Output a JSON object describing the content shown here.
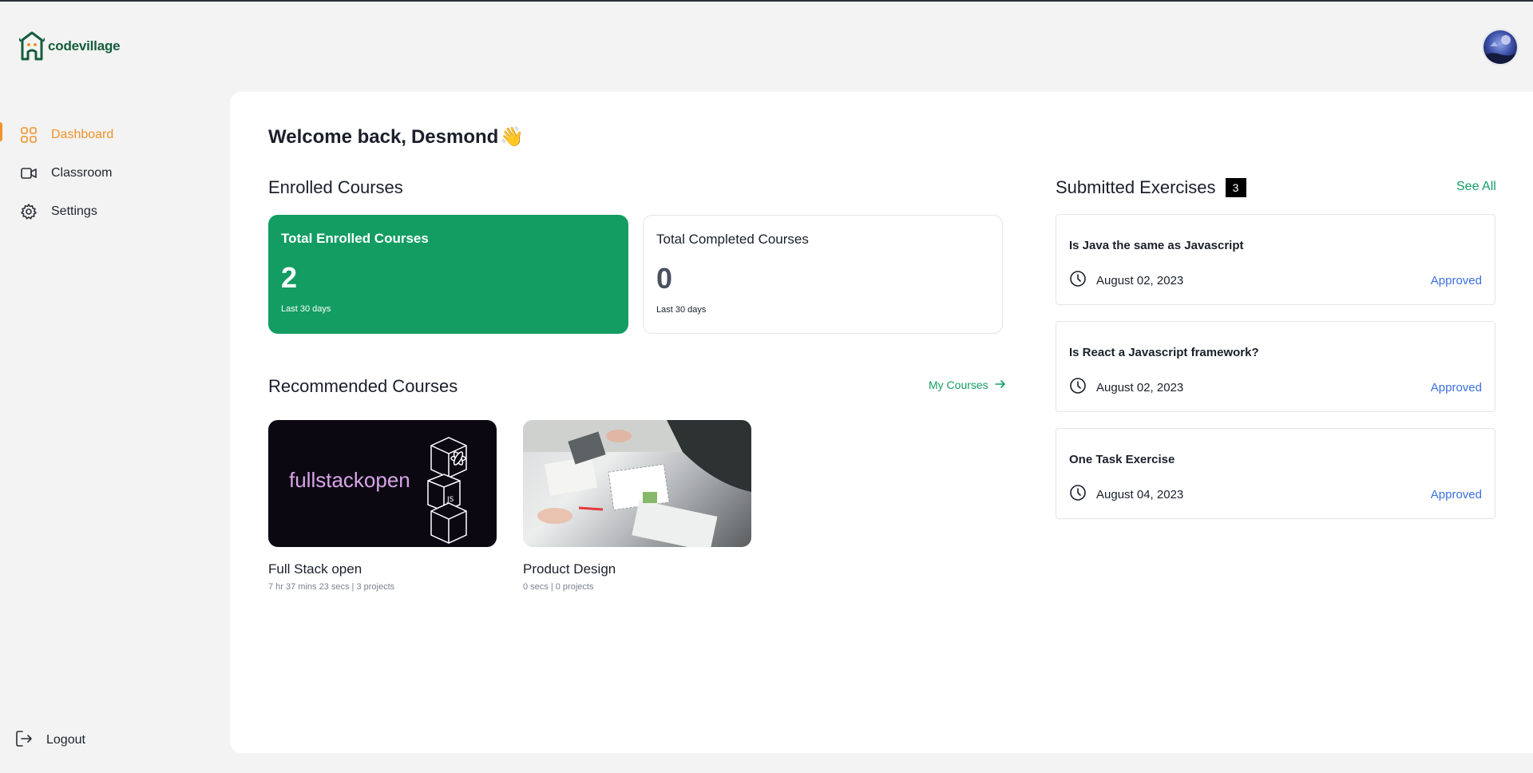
{
  "brand": {
    "name": "codevillage"
  },
  "sidebar": {
    "items": [
      {
        "label": "Dashboard",
        "icon": "grid-icon",
        "active": true
      },
      {
        "label": "Classroom",
        "icon": "video-icon",
        "active": false
      },
      {
        "label": "Settings",
        "icon": "gear-icon",
        "active": false
      }
    ],
    "logout_label": "Logout"
  },
  "welcome": {
    "prefix": "Welcome back,",
    "name": "Desmond",
    "emoji": "👋"
  },
  "enrolled": {
    "title": "Enrolled Courses",
    "cards": [
      {
        "title": "Total Enrolled Courses",
        "value": "2",
        "sub": "Last 30 days"
      },
      {
        "title": "Total Completed Courses",
        "value": "0",
        "sub": "Last 30 days"
      }
    ]
  },
  "recommended": {
    "title": "Recommended Courses",
    "link_label": "My Courses",
    "courses": [
      {
        "name": "Full Stack open",
        "meta": "7 hr 37 mins 23 secs | 3 projects",
        "thumb_text": "fullstackopen"
      },
      {
        "name": "Product Design",
        "meta": "0 secs | 0 projects"
      }
    ]
  },
  "submitted": {
    "title": "Submitted Exercises",
    "count": "3",
    "see_all_label": "See All",
    "items": [
      {
        "title": "Is Java the same as Javascript",
        "date": "August 02, 2023",
        "status": "Approved"
      },
      {
        "title": "Is React a Javascript framework?",
        "date": "August 02, 2023",
        "status": "Approved"
      },
      {
        "title": "One Task Exercise",
        "date": "August 04, 2023",
        "status": "Approved"
      }
    ]
  },
  "colors": {
    "accent_orange": "#f0932b",
    "brand_green": "#139d63",
    "status_blue": "#3b6fe0"
  }
}
